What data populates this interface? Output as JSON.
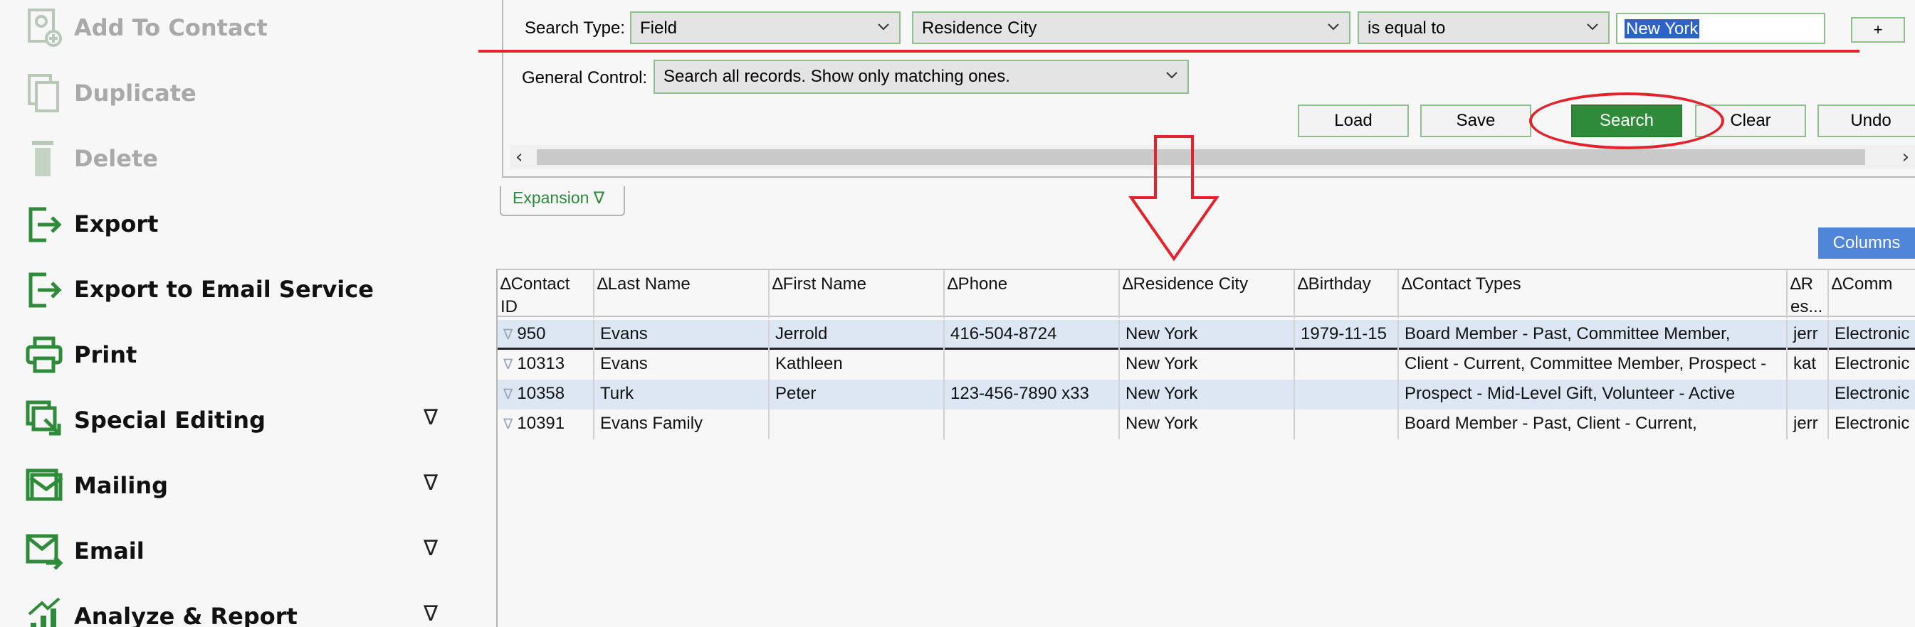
{
  "sidebar": {
    "items": [
      {
        "label": "Add To Contact",
        "disabled": true,
        "icon": "add-to-contact-icon"
      },
      {
        "label": "Duplicate",
        "disabled": true,
        "icon": "duplicate-icon"
      },
      {
        "label": "Delete",
        "disabled": true,
        "icon": "trash-icon"
      },
      {
        "label": "Export",
        "disabled": false,
        "icon": "export-icon"
      },
      {
        "label": "Export to Email Service",
        "disabled": false,
        "icon": "export-icon"
      },
      {
        "label": "Print",
        "disabled": false,
        "icon": "printer-icon"
      },
      {
        "label": "Special Editing",
        "disabled": false,
        "icon": "special-editing-icon",
        "chevron": "∇"
      },
      {
        "label": "Mailing",
        "disabled": false,
        "icon": "mailing-icon",
        "chevron": "∇"
      },
      {
        "label": "Email",
        "disabled": false,
        "icon": "email-icon",
        "chevron": "∇"
      },
      {
        "label": "Analyze & Report",
        "disabled": false,
        "icon": "analytics-icon",
        "chevron": "∇"
      }
    ]
  },
  "search": {
    "type_label": "Search Type:",
    "type_value": "Field",
    "field_value": "Residence City",
    "operator_value": "is equal to",
    "query_value": "New York",
    "add_label": "+",
    "general_label": "General Control:",
    "general_value": "Search all records. Show only matching ones.",
    "buttons": {
      "load": "Load",
      "save": "Save",
      "search": "Search",
      "clear": "Clear",
      "undo": "Undo"
    }
  },
  "expansion_label": "Expansion ∇",
  "columns_label": "Columns",
  "table": {
    "headers": [
      "∆Contact ID",
      "∆Last Name",
      "∆First Name",
      "∆Phone",
      "∆Residence City",
      "∆Birthday",
      "∆Contact Types",
      "∆R es...",
      "∆Comm"
    ],
    "rows": [
      [
        "950",
        "Evans",
        "Jerrold",
        "416-504-8724",
        "New York",
        "1979-11-15",
        "Board Member - Past, Committee Member,",
        "jerr",
        "Electronic"
      ],
      [
        "10313",
        "Evans",
        "Kathleen",
        "",
        "New York",
        "",
        "Client - Current, Committee Member, Prospect -",
        "kat",
        "Electronic"
      ],
      [
        "10358",
        "Turk",
        "Peter",
        "123-456-7890 x33",
        "New York",
        "",
        "Prospect - Mid-Level Gift, Volunteer - Active",
        "",
        "Electronic"
      ],
      [
        "10391",
        "Evans Family",
        "",
        "",
        "New York",
        "",
        "Board Member - Past, Client - Current,",
        "jerr",
        "Electronic"
      ]
    ],
    "row_marker": "∇"
  },
  "colors": {
    "accent_green": "#2e8b3a",
    "annotation_red": "#e3222b",
    "columns_blue": "#4f86d9",
    "row_alt": "#dde7f3"
  }
}
